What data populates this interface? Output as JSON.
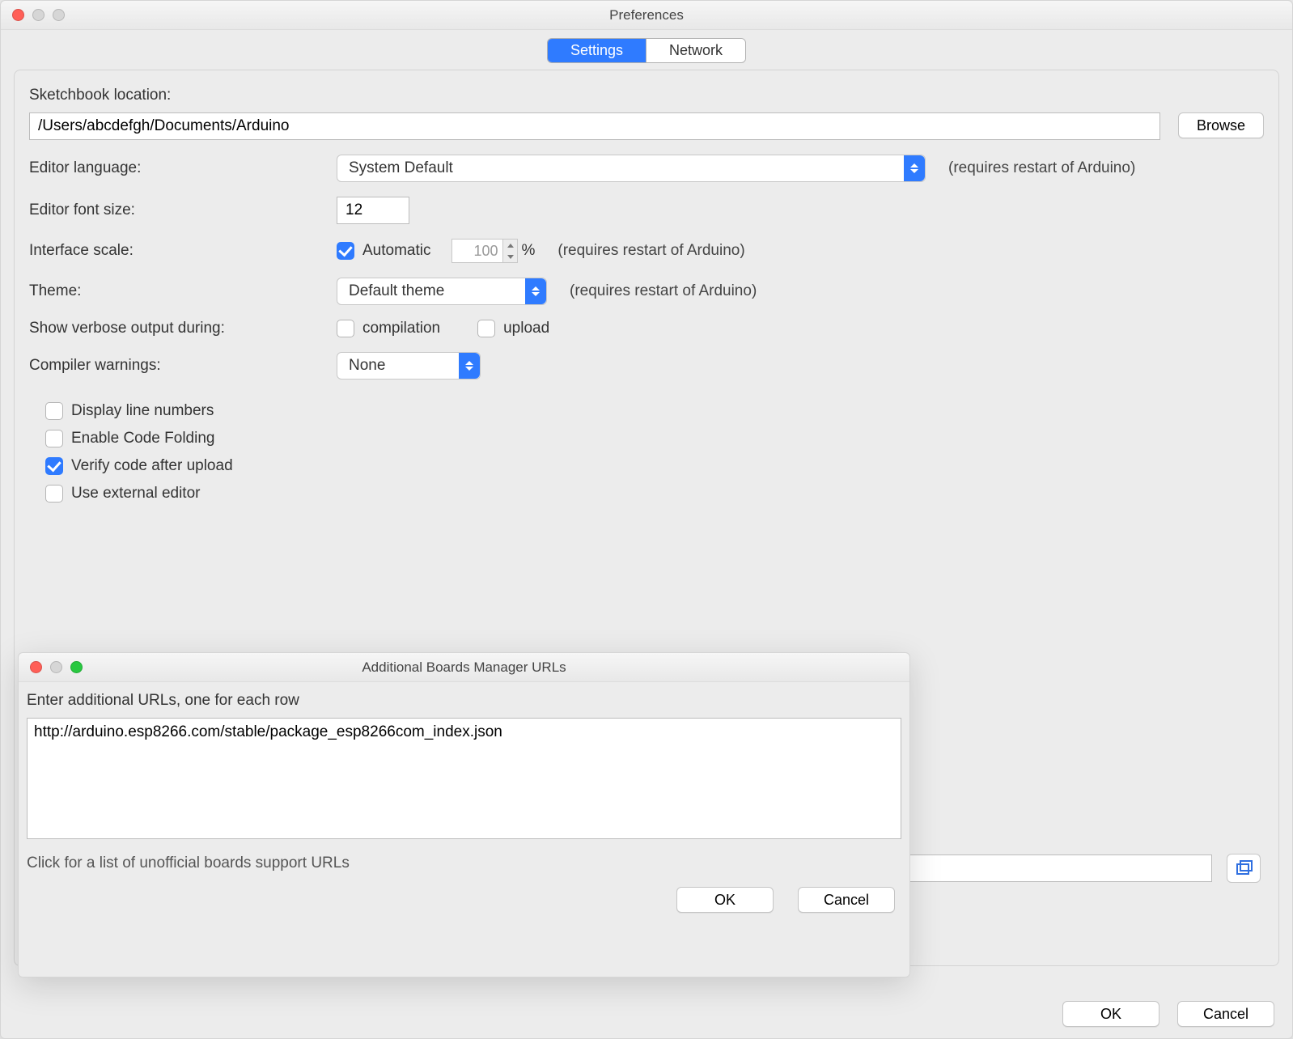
{
  "window": {
    "title": "Preferences"
  },
  "tabs": {
    "settings": "Settings",
    "network": "Network"
  },
  "sketchbook": {
    "label": "Sketchbook location:",
    "value": "/Users/abcdefgh/Documents/Arduino",
    "browse": "Browse"
  },
  "editorLanguage": {
    "label": "Editor language:",
    "value": "System Default",
    "hint": "(requires restart of Arduino)"
  },
  "editorFont": {
    "label": "Editor font size:",
    "value": "12"
  },
  "interfaceScale": {
    "label": "Interface scale:",
    "autoLabel": "Automatic",
    "value": "100",
    "percent": "%",
    "hint": "(requires restart of Arduino)"
  },
  "theme": {
    "label": "Theme:",
    "value": "Default theme",
    "hint": "(requires restart of Arduino)"
  },
  "verbose": {
    "label": "Show verbose output during:",
    "compilation": "compilation",
    "upload": "upload"
  },
  "compilerWarnings": {
    "label": "Compiler warnings:",
    "value": "None"
  },
  "options": {
    "lineNumbers": "Display line numbers",
    "codeFolding": "Enable Code Folding",
    "verifyUpload": "Verify code after upload",
    "externalEditor": "Use external editor"
  },
  "buttons": {
    "ok": "OK",
    "cancel": "Cancel"
  },
  "modal": {
    "title": "Additional Boards Manager URLs",
    "prompt": "Enter additional URLs, one for each row",
    "text": "http://arduino.esp8266.com/stable/package_esp8266com_index.json",
    "hint": "Click for a list of unofficial boards support URLs",
    "ok": "OK",
    "cancel": "Cancel"
  }
}
